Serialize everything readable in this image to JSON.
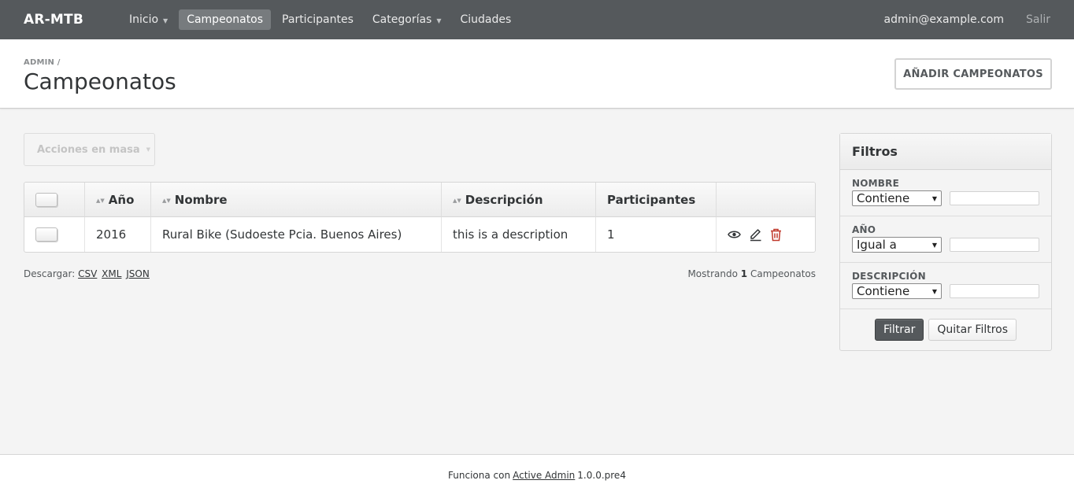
{
  "header": {
    "brand": "AR-MTB",
    "nav": [
      {
        "label": "Inicio",
        "dropdown": true
      },
      {
        "label": "Campeonatos",
        "dropdown": false,
        "active": true
      },
      {
        "label": "Participantes",
        "dropdown": false
      },
      {
        "label": "Categorías",
        "dropdown": true
      },
      {
        "label": "Ciudades",
        "dropdown": false
      }
    ],
    "user_email": "admin@example.com",
    "logout": "Salir"
  },
  "titlebar": {
    "breadcrumb": "ADMIN /",
    "title": "Campeonatos",
    "action_button": "AÑADIR CAMPEONATOS"
  },
  "main": {
    "batch_actions": "Acciones en masa",
    "table": {
      "columns": [
        "Año",
        "Nombre",
        "Descripción",
        "Participantes"
      ],
      "rows": [
        {
          "year": "2016",
          "name": "Rural Bike (Sudoeste Pcia. Buenos Aires)",
          "description": "this is a description",
          "participants": "1"
        }
      ]
    },
    "download_label": "Descargar:",
    "download_links": [
      "CSV",
      "XML",
      "JSON"
    ],
    "count_prefix": "Mostrando",
    "count_value": "1",
    "count_suffix": "Campeonatos"
  },
  "sidebar": {
    "title": "Filtros",
    "filters": [
      {
        "label": "NOMBRE",
        "operator": "Contiene",
        "value": ""
      },
      {
        "label": "AÑO",
        "operator": "Igual a",
        "value": ""
      },
      {
        "label": "DESCRIPCIÓN",
        "operator": "Contiene",
        "value": ""
      }
    ],
    "filter_button": "Filtrar",
    "clear_button": "Quitar Filtros"
  },
  "footer": {
    "prefix": "Funciona con",
    "link": "Active Admin",
    "version": "1.0.0.pre4"
  },
  "colors": {
    "header_bg": "#55595c",
    "delete_icon": "#c0392b"
  }
}
